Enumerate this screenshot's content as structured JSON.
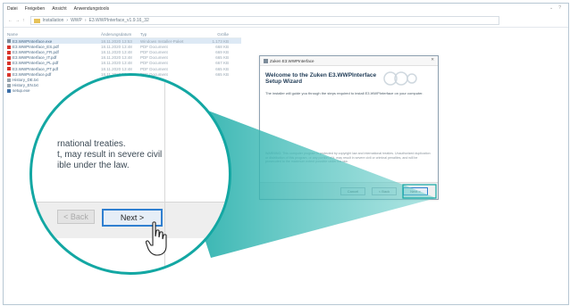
{
  "menu": [
    "Datei",
    "Freigeben",
    "Ansicht",
    "Anwendungstools"
  ],
  "address": {
    "crumbs": [
      "Installation",
      "WWP",
      "E3.WWPInterface_v1.9.16_32"
    ],
    "separator": "›"
  },
  "window_controls": [
    "⌄",
    "?"
  ],
  "file_list": {
    "headers": [
      "Name",
      "Änderungsdatum",
      "Typ",
      "Größe"
    ],
    "rows": [
      {
        "name": "E3.WWPInterface.exe",
        "date": "18.11.2020 13:53",
        "type": "Windows Installer-Paket",
        "size": "1.173 KB",
        "icon_color": "#7d8c9a",
        "selected": true
      },
      {
        "name": "E3.WWPInterface_ES.pdf",
        "date": "18.11.2020 13:48",
        "type": "PDF Document",
        "size": "668 KB",
        "icon_color": "#d9342b"
      },
      {
        "name": "E3.WWPInterface_FR.pdf",
        "date": "18.11.2020 13:48",
        "type": "PDF Document",
        "size": "669 KB",
        "icon_color": "#d9342b"
      },
      {
        "name": "E3.WWPInterface_IT.pdf",
        "date": "18.11.2020 13:48",
        "type": "PDF Document",
        "size": "665 KB",
        "icon_color": "#d9342b"
      },
      {
        "name": "E3.WWPInterface_PL.pdf",
        "date": "18.11.2020 13:48",
        "type": "PDF Document",
        "size": "667 KB",
        "icon_color": "#d9342b"
      },
      {
        "name": "E3.WWPInterface_PT.pdf",
        "date": "18.11.2020 13:48",
        "type": "PDF Document",
        "size": "665 KB",
        "icon_color": "#d9342b"
      },
      {
        "name": "E3.WWPInterface.pdf",
        "date": "18.11.2020 13:48",
        "type": "PDF Document",
        "size": "665 KB",
        "icon_color": "#d9342b"
      },
      {
        "name": "History_DE.txt",
        "date": "",
        "type": "",
        "size": "",
        "icon_color": "#9aa6b0"
      },
      {
        "name": "History_EN.txt",
        "date": "",
        "type": "",
        "size": "",
        "icon_color": "#9aa6b0"
      },
      {
        "name": "setup.exe",
        "date": "",
        "type": "",
        "size": "",
        "icon_color": "#3a6ea8"
      }
    ]
  },
  "dialog": {
    "title": "Zuken E3.WWPInterface",
    "close": "✕",
    "heading": "Welcome to the Zuken E3.WWPInterface Setup Wizard",
    "body": "The installer will guide you through the steps required to install E3.WWPInterface on your computer.",
    "warning": "WARNING: This computer program is protected by copyright law and international treaties. Unauthorized duplication or distribution of this program, or any portion of it, may result in severe civil or criminal penalties, and will be prosecuted to the maximum extent possible under the law.",
    "buttons": {
      "cancel": "Cancel",
      "back": "< Back",
      "next": "Next >"
    }
  },
  "zoom": {
    "lines": [
      "rnational treaties.",
      "t, may result in severe civil",
      "ible under the law."
    ],
    "back_label": "< Back",
    "next_label": "Next >"
  },
  "colors": {
    "teal": "#13a7a3",
    "teal_light": "#6fd0cc",
    "accent_blue": "#2f7fd0"
  }
}
